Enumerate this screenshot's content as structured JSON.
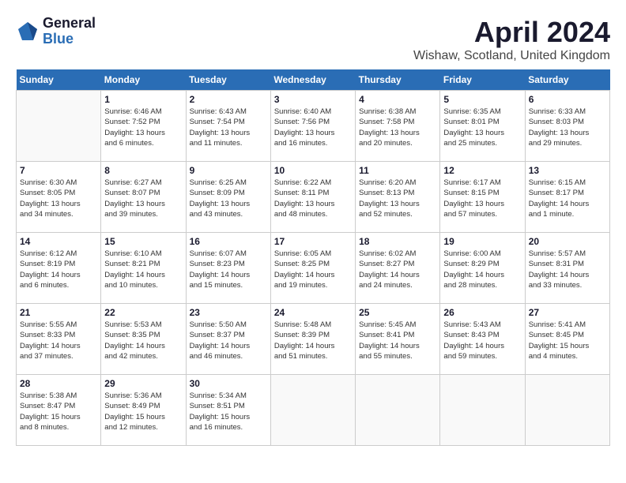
{
  "header": {
    "logo_general": "General",
    "logo_blue": "Blue",
    "title": "April 2024",
    "location": "Wishaw, Scotland, United Kingdom"
  },
  "days_of_week": [
    "Sunday",
    "Monday",
    "Tuesday",
    "Wednesday",
    "Thursday",
    "Friday",
    "Saturday"
  ],
  "weeks": [
    [
      {
        "day": "",
        "info": ""
      },
      {
        "day": "1",
        "info": "Sunrise: 6:46 AM\nSunset: 7:52 PM\nDaylight: 13 hours\nand 6 minutes."
      },
      {
        "day": "2",
        "info": "Sunrise: 6:43 AM\nSunset: 7:54 PM\nDaylight: 13 hours\nand 11 minutes."
      },
      {
        "day": "3",
        "info": "Sunrise: 6:40 AM\nSunset: 7:56 PM\nDaylight: 13 hours\nand 16 minutes."
      },
      {
        "day": "4",
        "info": "Sunrise: 6:38 AM\nSunset: 7:58 PM\nDaylight: 13 hours\nand 20 minutes."
      },
      {
        "day": "5",
        "info": "Sunrise: 6:35 AM\nSunset: 8:01 PM\nDaylight: 13 hours\nand 25 minutes."
      },
      {
        "day": "6",
        "info": "Sunrise: 6:33 AM\nSunset: 8:03 PM\nDaylight: 13 hours\nand 29 minutes."
      }
    ],
    [
      {
        "day": "7",
        "info": "Sunrise: 6:30 AM\nSunset: 8:05 PM\nDaylight: 13 hours\nand 34 minutes."
      },
      {
        "day": "8",
        "info": "Sunrise: 6:27 AM\nSunset: 8:07 PM\nDaylight: 13 hours\nand 39 minutes."
      },
      {
        "day": "9",
        "info": "Sunrise: 6:25 AM\nSunset: 8:09 PM\nDaylight: 13 hours\nand 43 minutes."
      },
      {
        "day": "10",
        "info": "Sunrise: 6:22 AM\nSunset: 8:11 PM\nDaylight: 13 hours\nand 48 minutes."
      },
      {
        "day": "11",
        "info": "Sunrise: 6:20 AM\nSunset: 8:13 PM\nDaylight: 13 hours\nand 52 minutes."
      },
      {
        "day": "12",
        "info": "Sunrise: 6:17 AM\nSunset: 8:15 PM\nDaylight: 13 hours\nand 57 minutes."
      },
      {
        "day": "13",
        "info": "Sunrise: 6:15 AM\nSunset: 8:17 PM\nDaylight: 14 hours\nand 1 minute."
      }
    ],
    [
      {
        "day": "14",
        "info": "Sunrise: 6:12 AM\nSunset: 8:19 PM\nDaylight: 14 hours\nand 6 minutes."
      },
      {
        "day": "15",
        "info": "Sunrise: 6:10 AM\nSunset: 8:21 PM\nDaylight: 14 hours\nand 10 minutes."
      },
      {
        "day": "16",
        "info": "Sunrise: 6:07 AM\nSunset: 8:23 PM\nDaylight: 14 hours\nand 15 minutes."
      },
      {
        "day": "17",
        "info": "Sunrise: 6:05 AM\nSunset: 8:25 PM\nDaylight: 14 hours\nand 19 minutes."
      },
      {
        "day": "18",
        "info": "Sunrise: 6:02 AM\nSunset: 8:27 PM\nDaylight: 14 hours\nand 24 minutes."
      },
      {
        "day": "19",
        "info": "Sunrise: 6:00 AM\nSunset: 8:29 PM\nDaylight: 14 hours\nand 28 minutes."
      },
      {
        "day": "20",
        "info": "Sunrise: 5:57 AM\nSunset: 8:31 PM\nDaylight: 14 hours\nand 33 minutes."
      }
    ],
    [
      {
        "day": "21",
        "info": "Sunrise: 5:55 AM\nSunset: 8:33 PM\nDaylight: 14 hours\nand 37 minutes."
      },
      {
        "day": "22",
        "info": "Sunrise: 5:53 AM\nSunset: 8:35 PM\nDaylight: 14 hours\nand 42 minutes."
      },
      {
        "day": "23",
        "info": "Sunrise: 5:50 AM\nSunset: 8:37 PM\nDaylight: 14 hours\nand 46 minutes."
      },
      {
        "day": "24",
        "info": "Sunrise: 5:48 AM\nSunset: 8:39 PM\nDaylight: 14 hours\nand 51 minutes."
      },
      {
        "day": "25",
        "info": "Sunrise: 5:45 AM\nSunset: 8:41 PM\nDaylight: 14 hours\nand 55 minutes."
      },
      {
        "day": "26",
        "info": "Sunrise: 5:43 AM\nSunset: 8:43 PM\nDaylight: 14 hours\nand 59 minutes."
      },
      {
        "day": "27",
        "info": "Sunrise: 5:41 AM\nSunset: 8:45 PM\nDaylight: 15 hours\nand 4 minutes."
      }
    ],
    [
      {
        "day": "28",
        "info": "Sunrise: 5:38 AM\nSunset: 8:47 PM\nDaylight: 15 hours\nand 8 minutes."
      },
      {
        "day": "29",
        "info": "Sunrise: 5:36 AM\nSunset: 8:49 PM\nDaylight: 15 hours\nand 12 minutes."
      },
      {
        "day": "30",
        "info": "Sunrise: 5:34 AM\nSunset: 8:51 PM\nDaylight: 15 hours\nand 16 minutes."
      },
      {
        "day": "",
        "info": ""
      },
      {
        "day": "",
        "info": ""
      },
      {
        "day": "",
        "info": ""
      },
      {
        "day": "",
        "info": ""
      }
    ]
  ]
}
